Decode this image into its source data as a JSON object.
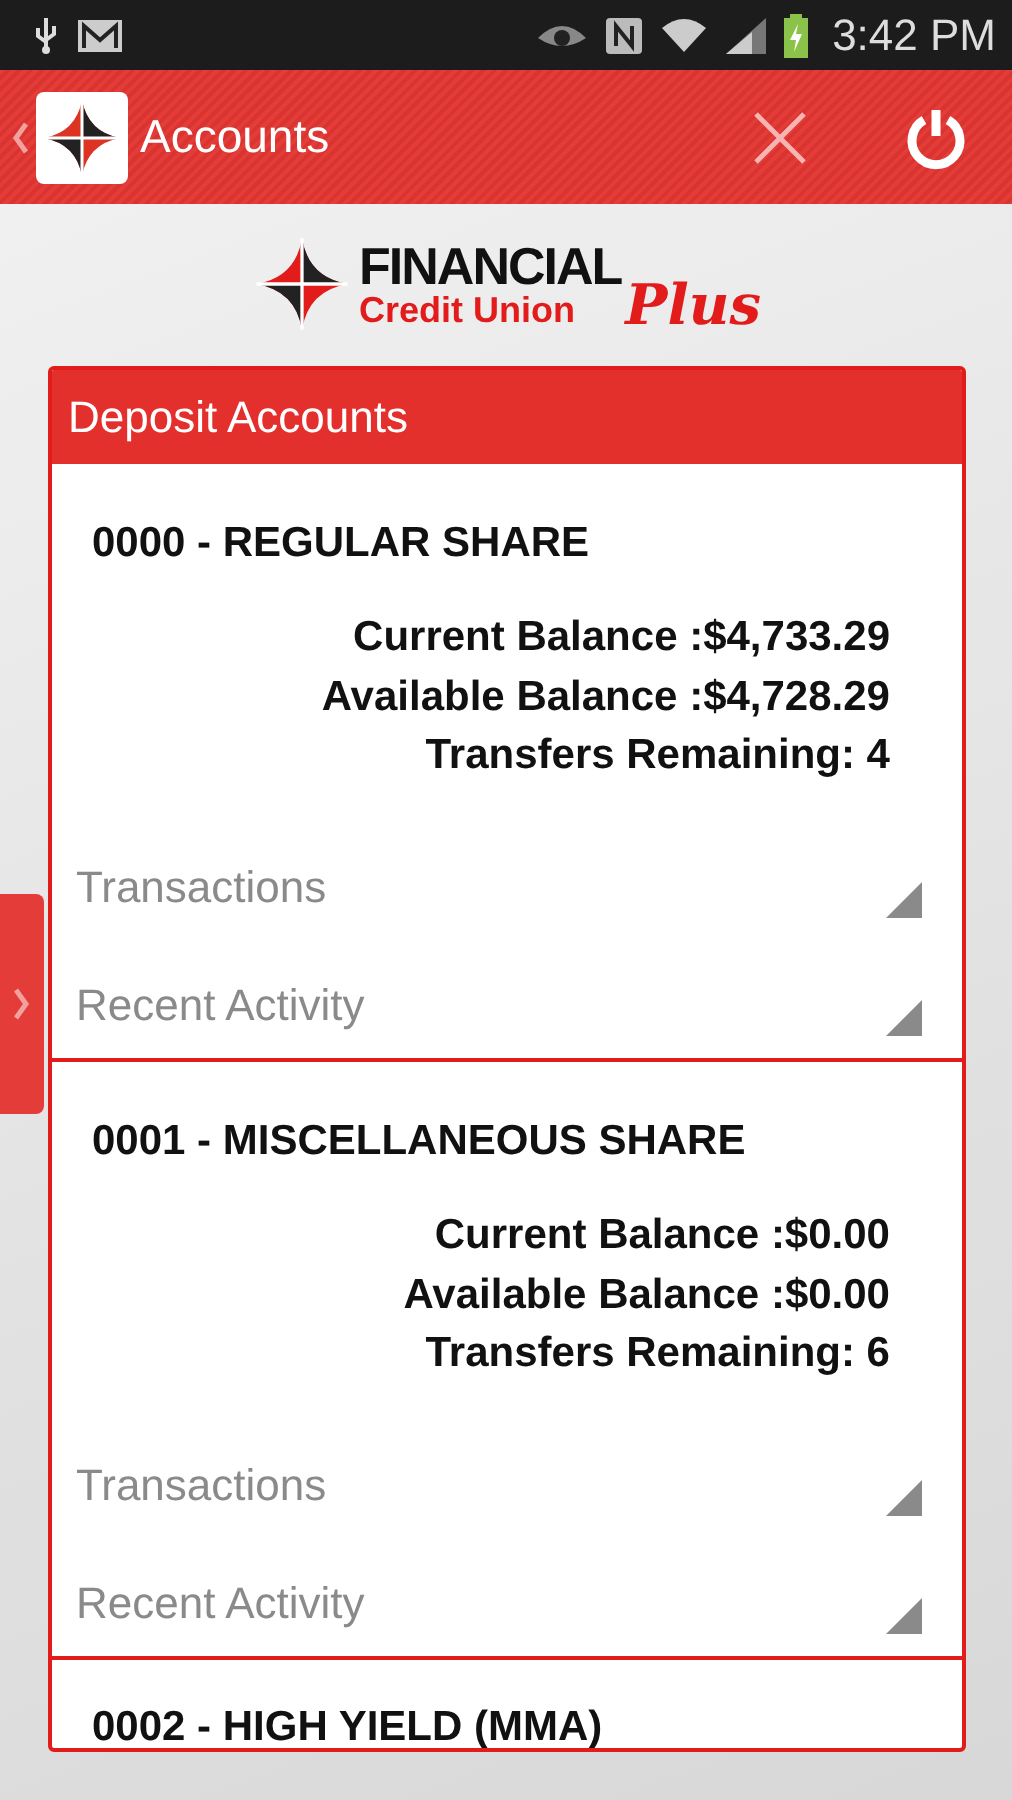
{
  "status_bar": {
    "time": "3:42 PM"
  },
  "app_bar": {
    "title": "Accounts"
  },
  "logo": {
    "word_1": "FINANCIAL",
    "word_2": "Credit Union",
    "word_3": "Plus"
  },
  "panel": {
    "title": "Deposit Accounts",
    "accounts": [
      {
        "name": "0000 - REGULAR SHARE",
        "lines": [
          "Current Balance :$4,733.29",
          "Available Balance :$4,728.29",
          "Transfers Remaining: 4"
        ],
        "sections": [
          {
            "label": "Transactions",
            "expanded": false
          },
          {
            "label": "Recent Activity",
            "expanded": false
          }
        ]
      },
      {
        "name": "0001 - MISCELLANEOUS SHARE",
        "lines": [
          "Current Balance :$0.00",
          "Available Balance :$0.00",
          "Transfers Remaining: 6"
        ],
        "sections": [
          {
            "label": "Transactions",
            "expanded": false
          },
          {
            "label": "Recent Activity",
            "expanded": false
          }
        ]
      },
      {
        "name": "0002 - HIGH YIELD (MMA)"
      }
    ]
  }
}
